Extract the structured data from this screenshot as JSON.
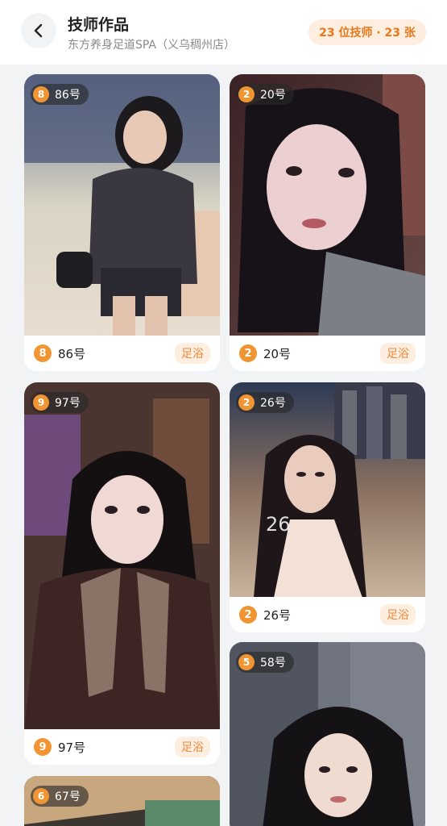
{
  "header": {
    "title": "技师作品",
    "subtitle": "东方养身足道SPA（义乌稠州店）",
    "stats": "23 位技师 · 23 张",
    "back_icon": "chevron-left-icon"
  },
  "colors": {
    "accent": "#e8761a",
    "rank_badge": "#f19533",
    "service_badge_bg": "#fdeee0"
  },
  "cards": [
    {
      "rank": "8",
      "name": "86号",
      "service": "足浴"
    },
    {
      "rank": "2",
      "name": "20号",
      "service": "足浴"
    },
    {
      "rank": "9",
      "name": "97号",
      "service": "足浴"
    },
    {
      "rank": "2",
      "name": "26号",
      "service": "足浴",
      "photo_text": "26"
    },
    {
      "rank": "5",
      "name": "58号"
    },
    {
      "rank": "6",
      "name": "67号"
    }
  ]
}
